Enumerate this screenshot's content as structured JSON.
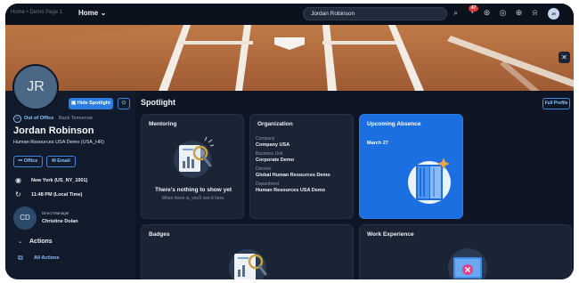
{
  "shell": {
    "logo_text": "Home • Demo Page 1",
    "home_label": "Home",
    "search_value": "Jordan Robinson",
    "notification_count": "47",
    "avatar_initials": "JR"
  },
  "profile": {
    "initials": "JR",
    "hide_spotlight_label": "Hide Spotlight",
    "status": "Out of Office",
    "status_note": "Back Tomorrow",
    "name": "Jordan Robinson",
    "org": "Human Resources USA Demo (USA_HR)",
    "office_label": "Office",
    "email_label": "Email",
    "location": "New York (US_NY_1001)",
    "local_time": "11:48 PM (Local Time)",
    "manager_initials": "CD",
    "manager_label": "Direct Manager",
    "manager_name": "Christine Dolan",
    "actions_label": "Actions",
    "all_actions_label": "All Actions"
  },
  "spotlight": {
    "title": "Spotlight",
    "full_profile_label": "Full Profile"
  },
  "mentoring": {
    "title": "Mentoring",
    "empty_title": "There's nothing to show yet",
    "empty_sub": "When there is, you'll see it here."
  },
  "organization": {
    "title": "Organization",
    "company_label": "Company",
    "company_value": "Company USA",
    "bu_label": "Business Unit",
    "bu_value": "Corporate Demo",
    "division_label": "Division",
    "division_value": "Global Human Resources Demo",
    "dept_label": "Department",
    "dept_value": "Human Resources USA Demo"
  },
  "absence": {
    "title": "Upcoming Absence",
    "date": "March 27"
  },
  "badges": {
    "title": "Badges"
  },
  "work": {
    "title": "Work Experience"
  },
  "colors": {
    "accent": "#2b7de0",
    "absence_card": "#1c6fe0",
    "background": "#0e1626",
    "card": "#1a2434"
  }
}
